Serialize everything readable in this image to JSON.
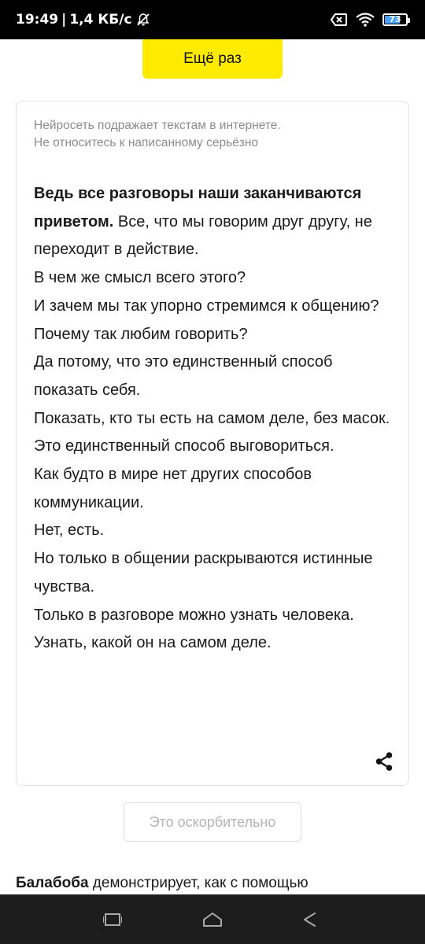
{
  "status_bar": {
    "time": "19:49",
    "separator": "|",
    "speed": "1,4 КБ/с",
    "battery_level": "73",
    "battery_fraction": 0.73,
    "icons": [
      "mute-icon",
      "sim-off-icon",
      "wifi-icon",
      "battery-icon"
    ]
  },
  "again_button": {
    "label": "Ещё раз"
  },
  "card": {
    "disclaimer": [
      "Нейросеть подражает текстам в интернете.",
      "Не относитесь к написанному серьёзно"
    ],
    "prompt_bold": "Ведь все разговоры наши заканчиваются приветом.",
    "first_continuation": " Все, что мы говорим друг другу, не переходит в действие.",
    "paragraphs": [
      "В чем же смысл всего этого?",
      "И зачем мы так упорно стремимся к общению?",
      "Почему так любим говорить?",
      "Да потому, что это единственный способ показать себя.",
      "Показать, кто ты есть на самом деле, без масок.",
      "Это единственный способ выговориться.",
      "Как будто в мире нет других способов коммуникации.",
      "Нет, есть.",
      "Но только в общении раскрываются истинные чувства.",
      "Только в разговоре можно узнать человека.",
      "Узнать, какой он на самом деле."
    ],
    "share_icon": "share-icon"
  },
  "report_button": {
    "label": "Это оскорбительно"
  },
  "footer": {
    "brand": "Балабоба",
    "text": " демонстрирует, как с помощью"
  },
  "nav_bar": {
    "icons": [
      "recents-icon",
      "home-icon",
      "back-icon"
    ]
  }
}
